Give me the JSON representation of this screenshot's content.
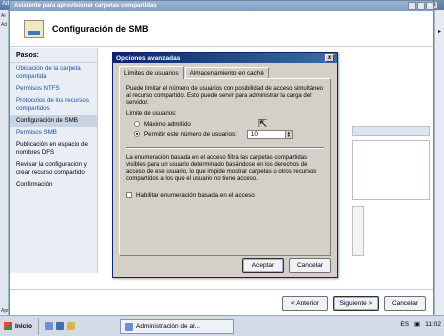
{
  "background": {
    "title": "Administración de al...",
    "left_strip": [
      "Ad",
      "Ar",
      "Ad",
      "Aprovis"
    ]
  },
  "wizard": {
    "title": "Asistente para aprovisionar carpetas compartidas",
    "header": "Configuración de SMB",
    "steps_label": "Pasos:",
    "steps": [
      "Ubicación de la carpeta compartida",
      "Permisos NTFS",
      "Protocolos de los recursos compartidos",
      "Configuración de SMB",
      "Permisos SMB",
      "Publicación en espacio de nombres DFS",
      "Revisar la configuración y crear recurso compartido",
      "Confirmación"
    ],
    "buttons": {
      "back": "< Anterior",
      "next": "Siguiente >",
      "cancel": "Cancelar"
    }
  },
  "dialog": {
    "title": "Opciones avanzadas",
    "close": "x",
    "tabs": [
      "Límites de usuarios",
      "Almacenamiento en caché"
    ],
    "description": "Puede limitar el número de usuarios con posibilidad de acceso simultáneo al recurso compartido. Esto puede servir para administrar la carga del servidor.",
    "limit_label": "Límite de usuarios:",
    "option_max": "Máximo admitido",
    "option_allow": "Permitir este número de usuarios:",
    "user_count": "10",
    "enum_text": "La enumeración basada en el acceso filtra las carpetas compartidas visibles para un usuario determinado basándose en los derechos de acceso de ese usuario, lo que impide mostrar carpetas u otros recursos compartidos a los que el usuario no tiene acceso.",
    "enable_enum": "Habilitar enumeración basada en el acceso",
    "ok": "Aceptar",
    "cancel": "Cancelar"
  },
  "taskbar": {
    "start": "Inicio",
    "task": "Administración de al...",
    "lang": "ES",
    "time": "11:02"
  },
  "colors": {
    "titlebar": "#0a246a",
    "dialog_bg": "#d4d0c8",
    "link": "#1b4fa0"
  }
}
